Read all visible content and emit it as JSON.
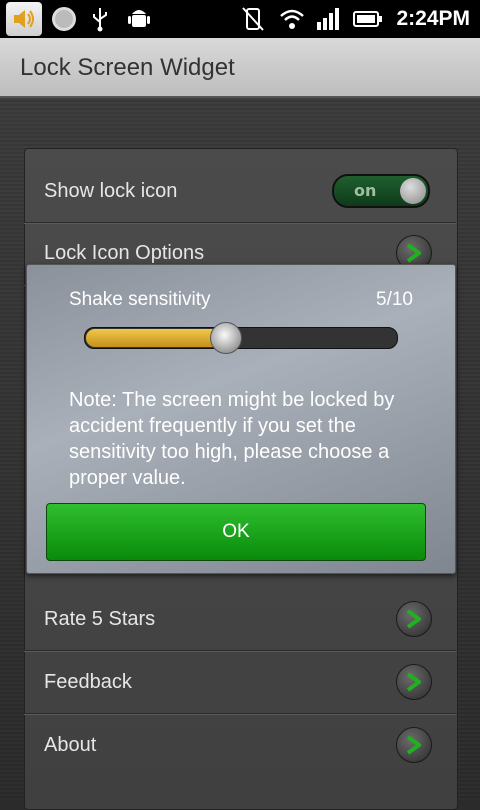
{
  "status_bar": {
    "time": "2:24PM",
    "icons": [
      "speaker-icon",
      "circle-icon",
      "usb-icon",
      "android-debug-icon",
      "vibrate-off-icon",
      "wifi-icon",
      "signal-icon",
      "battery-icon"
    ]
  },
  "app": {
    "title": "Lock Screen Widget"
  },
  "settings": {
    "rows": [
      {
        "label": "Show lock icon",
        "toggle": "on"
      },
      {
        "label": "Lock Icon Options"
      },
      {
        "label": ""
      },
      {
        "label": ""
      },
      {
        "label": ""
      },
      {
        "label": "Rate 5 Stars"
      },
      {
        "label": "Feedback"
      },
      {
        "label": "About"
      }
    ]
  },
  "dialog": {
    "title": "Shake sensitivity",
    "value_text": "5/10",
    "slider": {
      "value": 5,
      "max": 10
    },
    "note": "Note: The screen might be locked by accident frequently if you set the sensitivity too high, please choose a proper value.",
    "ok_label": "OK"
  },
  "colors": {
    "accent_green": "#1ba91b",
    "slider_fill": "#e0b035"
  }
}
